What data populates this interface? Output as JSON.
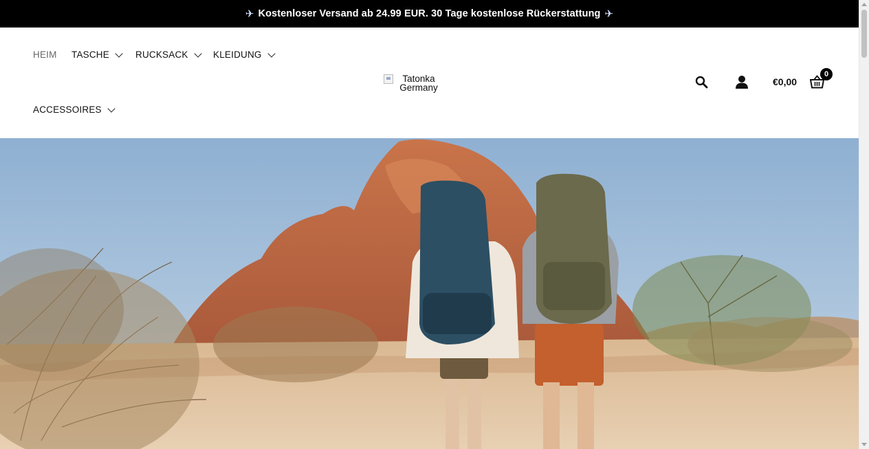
{
  "announcement": {
    "text": "Kostenloser Versand ab 24.99 EUR. 30 Tage kostenlose Rückerstattung",
    "icon": "airplane-icon"
  },
  "nav": {
    "items": [
      {
        "label": "HEIM",
        "active": true,
        "has_dropdown": false
      },
      {
        "label": "TASCHE",
        "active": false,
        "has_dropdown": true
      },
      {
        "label": "RUCKSACK",
        "active": false,
        "has_dropdown": true
      },
      {
        "label": "KLEIDUNG",
        "active": false,
        "has_dropdown": true
      },
      {
        "label": "ACCESSOIRES",
        "active": false,
        "has_dropdown": true
      }
    ]
  },
  "logo": {
    "alt": "Tatonka Germany"
  },
  "header_actions": {
    "search_icon": "search-icon",
    "account_icon": "user-icon",
    "cart_total": "€0,00",
    "cart_icon": "basket-icon",
    "cart_count": "0"
  },
  "hero": {
    "description_icon": "hero-photo"
  },
  "colors": {
    "announcement_bg": "#000000",
    "nav_active": "#666666",
    "text": "#111111"
  }
}
